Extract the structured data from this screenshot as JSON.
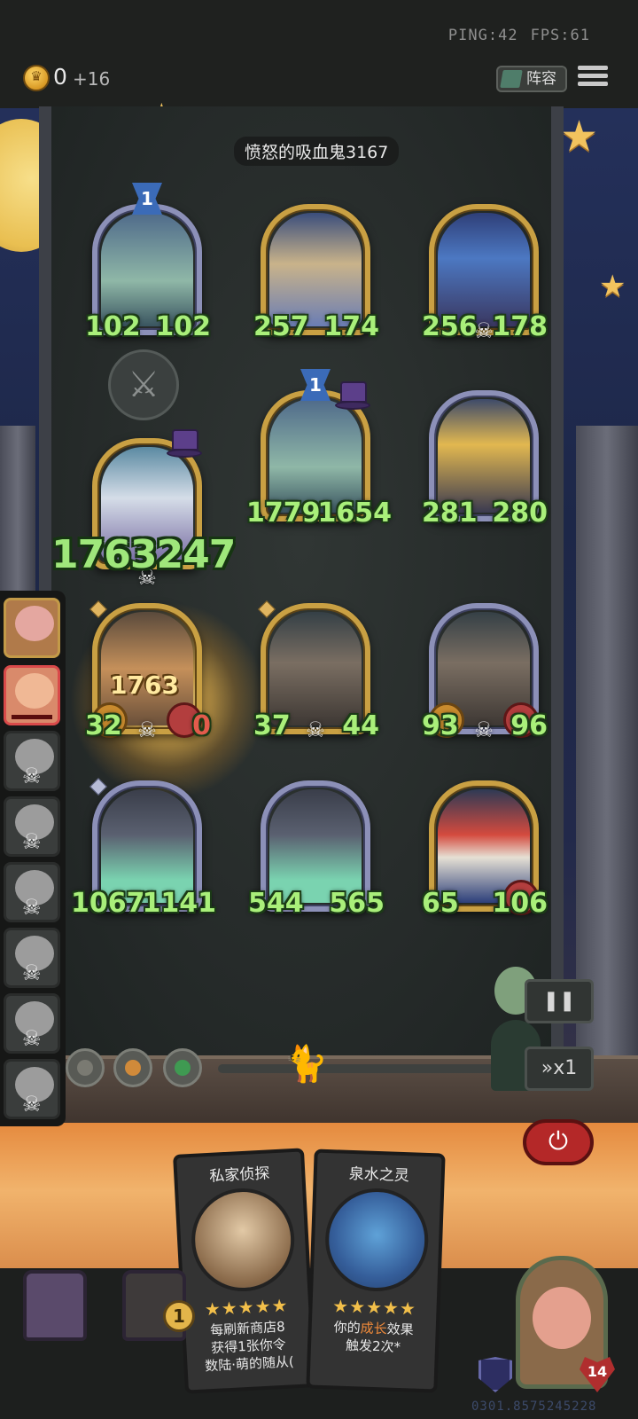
{
  "hud": {
    "ping": "PING:42",
    "fps": "FPS:61",
    "gold": "0",
    "gold_income": "+16",
    "lineup_label": "阵容",
    "menu_icon": "hamburger-icon"
  },
  "opponent": {
    "name": "愤怒的吸血鬼3167"
  },
  "enemy_units": [
    {
      "atk": "102",
      "hp": "102",
      "level": "1"
    },
    {
      "atk": "257",
      "hp": "174"
    },
    {
      "atk": "256",
      "hp": "178"
    },
    {
      "atk": "1779",
      "hp": "1654",
      "level": "1"
    },
    {
      "atk": "281",
      "hp": "280"
    },
    {
      "atk_hp_combined": "1763247"
    }
  ],
  "ally_units": [
    {
      "atk": "32",
      "hp": "0",
      "damage_text": "1763"
    },
    {
      "atk": "37",
      "hp": "44"
    },
    {
      "atk": "93",
      "hp": "96"
    },
    {
      "atk": "1067",
      "hp": "1141"
    },
    {
      "atk": "544",
      "hp": "565"
    },
    {
      "atk": "65",
      "hp": "106"
    }
  ],
  "controls": {
    "pause_icon": "pause-icon",
    "speed_label": "x1",
    "power_icon": "power-icon"
  },
  "shop": {
    "cards": [
      {
        "title": "私家侦探",
        "stars": "★★★★★",
        "desc_line1": "每刷新商店8",
        "desc_line2": "获得1张你令",
        "desc_line3": "数陆·萌的随从("
      },
      {
        "title": "泉水之灵",
        "stars": "★★★★★",
        "desc_pre": "你的",
        "desc_hl": "成长",
        "desc_post": "效果",
        "desc_line2": "触发2次*"
      }
    ],
    "counter": "1"
  },
  "hero": {
    "hp": "14"
  },
  "footer": {
    "uid": "0301.8575245228"
  },
  "colors": {
    "stat_green": "#a9ef7a",
    "gold_frame": "#c9a043",
    "silver_frame": "#8c90b8",
    "power_red": "#b42828"
  }
}
